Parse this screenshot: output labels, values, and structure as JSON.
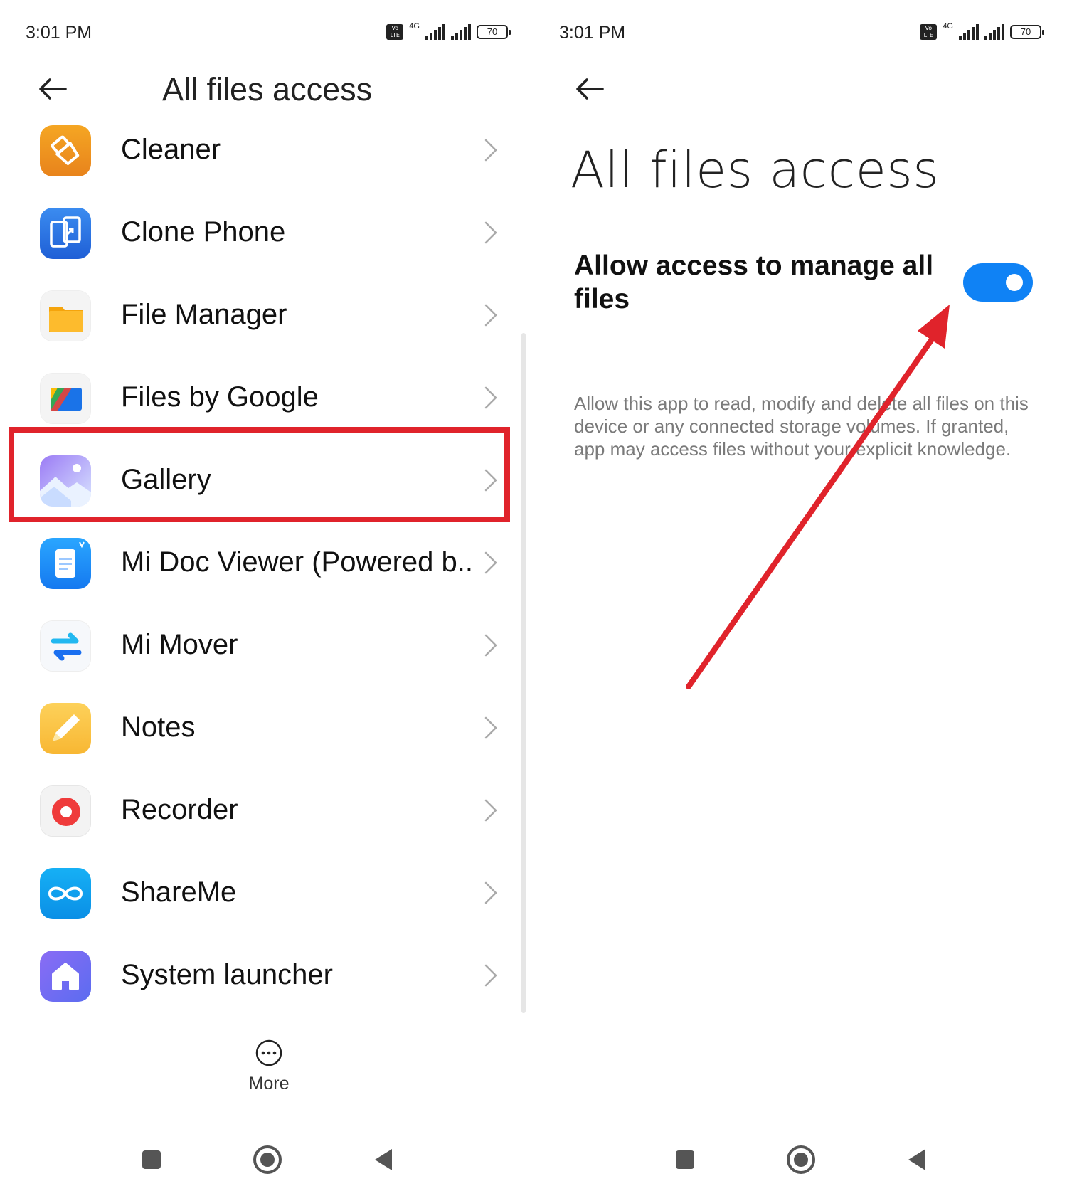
{
  "left": {
    "status": {
      "time": "3:01 PM",
      "volte": "Vo\nLTE",
      "network": "4G",
      "battery": "70"
    },
    "title": "All files access",
    "apps": [
      {
        "name": "Cleaner",
        "icon": "cleaner-icon"
      },
      {
        "name": "Clone Phone",
        "icon": "clone-phone-icon"
      },
      {
        "name": "File Manager",
        "icon": "file-manager-icon"
      },
      {
        "name": "Files by Google",
        "icon": "files-by-google-icon"
      },
      {
        "name": "Gallery",
        "icon": "gallery-icon"
      },
      {
        "name": "Mi Doc Viewer (Powered b..",
        "icon": "mi-doc-viewer-icon"
      },
      {
        "name": "Mi Mover",
        "icon": "mi-mover-icon"
      },
      {
        "name": "Notes",
        "icon": "notes-icon"
      },
      {
        "name": "Recorder",
        "icon": "recorder-icon"
      },
      {
        "name": "ShareMe",
        "icon": "shareme-icon"
      },
      {
        "name": "System launcher",
        "icon": "system-launcher-icon"
      }
    ],
    "highlighted_app": "Gallery",
    "more_label": "More"
  },
  "right": {
    "status": {
      "time": "3:01 PM",
      "volte": "Vo\nLTE",
      "network": "4G",
      "battery": "70"
    },
    "title": "All files access",
    "setting_label": "Allow access to manage all files",
    "toggle_on": true,
    "description": "Allow this app to read, modify and delete all files on this device or any connected storage volumes. If granted, app may access files without your explicit knowledge."
  },
  "colors": {
    "accent": "#0f82f5",
    "annotation_red": "#e0232b"
  }
}
